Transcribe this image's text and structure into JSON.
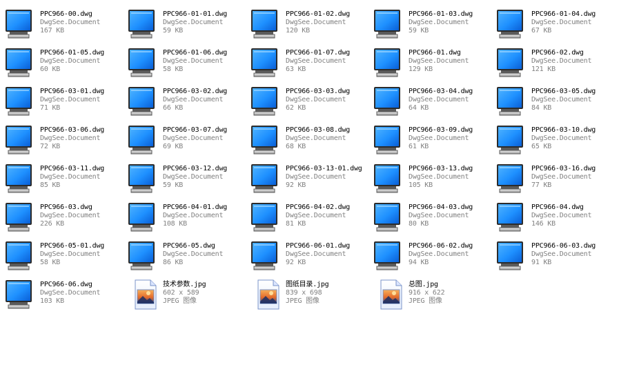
{
  "files": [
    {
      "name": "PPC966-00.dwg",
      "line2": "DwgSee.Document",
      "line3": "167 KB",
      "icon": "dwg-document-icon"
    },
    {
      "name": "PPC966-01-01.dwg",
      "line2": "DwgSee.Document",
      "line3": "59 KB",
      "icon": "dwg-document-icon"
    },
    {
      "name": "PPC966-01-02.dwg",
      "line2": "DwgSee.Document",
      "line3": "120 KB",
      "icon": "dwg-document-icon"
    },
    {
      "name": "PPC966-01-03.dwg",
      "line2": "DwgSee.Document",
      "line3": "59 KB",
      "icon": "dwg-document-icon"
    },
    {
      "name": "PPC966-01-04.dwg",
      "line2": "DwgSee.Document",
      "line3": "67 KB",
      "icon": "dwg-document-icon"
    },
    {
      "name": "PPC966-01-05.dwg",
      "line2": "DwgSee.Document",
      "line3": "60 KB",
      "icon": "dwg-document-icon"
    },
    {
      "name": "PPC966-01-06.dwg",
      "line2": "DwgSee.Document",
      "line3": "58 KB",
      "icon": "dwg-document-icon"
    },
    {
      "name": "PPC966-01-07.dwg",
      "line2": "DwgSee.Document",
      "line3": "63 KB",
      "icon": "dwg-document-icon"
    },
    {
      "name": "PPC966-01.dwg",
      "line2": "DwgSee.Document",
      "line3": "129 KB",
      "icon": "dwg-document-icon"
    },
    {
      "name": "PPC966-02.dwg",
      "line2": "DwgSee.Document",
      "line3": "121 KB",
      "icon": "dwg-document-icon"
    },
    {
      "name": "PPC966-03-01.dwg",
      "line2": "DwgSee.Document",
      "line3": "71 KB",
      "icon": "dwg-document-icon"
    },
    {
      "name": "PPC966-03-02.dwg",
      "line2": "DwgSee.Document",
      "line3": "66 KB",
      "icon": "dwg-document-icon"
    },
    {
      "name": "PPC966-03-03.dwg",
      "line2": "DwgSee.Document",
      "line3": "62 KB",
      "icon": "dwg-document-icon"
    },
    {
      "name": "PPC966-03-04.dwg",
      "line2": "DwgSee.Document",
      "line3": "64 KB",
      "icon": "dwg-document-icon"
    },
    {
      "name": "PPC966-03-05.dwg",
      "line2": "DwgSee.Document",
      "line3": "84 KB",
      "icon": "dwg-document-icon"
    },
    {
      "name": "PPC966-03-06.dwg",
      "line2": "DwgSee.Document",
      "line3": "72 KB",
      "icon": "dwg-document-icon"
    },
    {
      "name": "PPC966-03-07.dwg",
      "line2": "DwgSee.Document",
      "line3": "69 KB",
      "icon": "dwg-document-icon"
    },
    {
      "name": "PPC966-03-08.dwg",
      "line2": "DwgSee.Document",
      "line3": "68 KB",
      "icon": "dwg-document-icon"
    },
    {
      "name": "PPC966-03-09.dwg",
      "line2": "DwgSee.Document",
      "line3": "61 KB",
      "icon": "dwg-document-icon"
    },
    {
      "name": "PPC966-03-10.dwg",
      "line2": "DwgSee.Document",
      "line3": "65 KB",
      "icon": "dwg-document-icon"
    },
    {
      "name": "PPC966-03-11.dwg",
      "line2": "DwgSee.Document",
      "line3": "85 KB",
      "icon": "dwg-document-icon"
    },
    {
      "name": "PPC966-03-12.dwg",
      "line2": "DwgSee.Document",
      "line3": "59 KB",
      "icon": "dwg-document-icon"
    },
    {
      "name": "PPC966-03-13-01.dwg",
      "line2": "DwgSee.Document",
      "line3": "92 KB",
      "icon": "dwg-document-icon"
    },
    {
      "name": "PPC966-03-13.dwg",
      "line2": "DwgSee.Document",
      "line3": "105 KB",
      "icon": "dwg-document-icon"
    },
    {
      "name": "PPC966-03-16.dwg",
      "line2": "DwgSee.Document",
      "line3": "77 KB",
      "icon": "dwg-document-icon"
    },
    {
      "name": "PPC966-03.dwg",
      "line2": "DwgSee.Document",
      "line3": "226 KB",
      "icon": "dwg-document-icon"
    },
    {
      "name": "PPC966-04-01.dwg",
      "line2": "DwgSee.Document",
      "line3": "108 KB",
      "icon": "dwg-document-icon"
    },
    {
      "name": "PPC966-04-02.dwg",
      "line2": "DwgSee.Document",
      "line3": "81 KB",
      "icon": "dwg-document-icon"
    },
    {
      "name": "PPC966-04-03.dwg",
      "line2": "DwgSee.Document",
      "line3": "80 KB",
      "icon": "dwg-document-icon"
    },
    {
      "name": "PPC966-04.dwg",
      "line2": "DwgSee.Document",
      "line3": "146 KB",
      "icon": "dwg-document-icon"
    },
    {
      "name": "PPC966-05-01.dwg",
      "line2": "DwgSee.Document",
      "line3": "58 KB",
      "icon": "dwg-document-icon"
    },
    {
      "name": "PPC966-05.dwg",
      "line2": "DwgSee.Document",
      "line3": "86 KB",
      "icon": "dwg-document-icon"
    },
    {
      "name": "PPC966-06-01.dwg",
      "line2": "DwgSee.Document",
      "line3": "92 KB",
      "icon": "dwg-document-icon"
    },
    {
      "name": "PPC966-06-02.dwg",
      "line2": "DwgSee.Document",
      "line3": "94 KB",
      "icon": "dwg-document-icon"
    },
    {
      "name": "PPC966-06-03.dwg",
      "line2": "DwgSee.Document",
      "line3": "91 KB",
      "icon": "dwg-document-icon"
    },
    {
      "name": "PPC966-06.dwg",
      "line2": "DwgSee.Document",
      "line3": "103 KB",
      "icon": "dwg-document-icon"
    },
    {
      "name": "技术参数.jpg",
      "line2": "602 x 589",
      "line3": "JPEG 图像",
      "icon": "jpeg-image-icon"
    },
    {
      "name": "图纸目录.jpg",
      "line2": "839 x 698",
      "line3": "JPEG 图像",
      "icon": "jpeg-image-icon"
    },
    {
      "name": "总图.jpg",
      "line2": "916 x 622",
      "line3": "JPEG 图像",
      "icon": "jpeg-image-icon"
    }
  ],
  "colors": {
    "background": "#ffffff",
    "name_text": "#000000",
    "meta_text": "#808080",
    "monitor_screen": "#1e90ff",
    "monitor_frame": "#c8c8c8"
  }
}
